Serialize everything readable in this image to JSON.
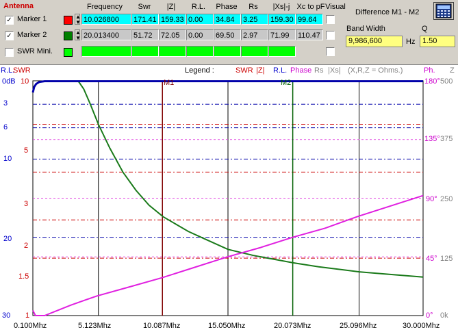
{
  "header": {
    "antenna": "Antenna",
    "columns": [
      "Frequency",
      "Swr",
      "|Z|",
      "R.L.",
      "Phase",
      "Rs",
      "|Xs|-j",
      "Xc to pF",
      "Visual"
    ],
    "difference_title": "Difference M1 - M2",
    "bandwidth_label": "Band Width",
    "bandwidth_value": "9,986,600",
    "hz_label": "Hz",
    "q_label": "Q",
    "q_value": "1.50"
  },
  "markers": [
    {
      "label": "Marker 1",
      "checked": true,
      "color": "#ff0000",
      "values": [
        "10.026800",
        "171.41",
        "159.33",
        "0.00",
        "34.84",
        "3.25",
        "159.30",
        "99.64"
      ]
    },
    {
      "label": "Marker 2",
      "checked": true,
      "color": "#008000",
      "values": [
        "20.013400",
        "51.72",
        "72.05",
        "0.00",
        "69.50",
        "2.97",
        "71.99",
        "110.47"
      ]
    }
  ],
  "swr_mini": {
    "label": "SWR Mini.",
    "checked": false,
    "color": "#00ff00"
  },
  "legend": {
    "left_label": "R.L.",
    "swr_label": "SWR",
    "title": "Legend :",
    "items": [
      {
        "text": "SWR",
        "color": "#cc0000"
      },
      {
        "text": "|Z|",
        "color": "#cc0000"
      },
      {
        "text": "R.L.",
        "color": "#0000cc"
      },
      {
        "text": "Phase",
        "color": "#cc00cc"
      },
      {
        "text": "Rs",
        "color": "#808080"
      },
      {
        "text": "|Xs|",
        "color": "#808080"
      },
      {
        "text": "(X,R,Z = Ohms.)",
        "color": "#808080"
      }
    ],
    "ph_label": "Ph.",
    "z_label": "Z"
  },
  "chart_data": {
    "type": "line",
    "x_ticks": [
      "0.100Mhz",
      "5.123Mhz",
      "10.087Mhz",
      "15.050Mhz",
      "20.073Mhz",
      "25.096Mhz",
      "30.000Mhz"
    ],
    "xlim": [
      0.1,
      30.0
    ],
    "rl_ticks": [
      "0dB",
      "3",
      "6",
      "10",
      "20",
      "30"
    ],
    "swr_ticks": [
      "10",
      "5",
      "3",
      "2",
      "1.5",
      "1"
    ],
    "phase_ticks": [
      "180°",
      "135°",
      "90°",
      "45°",
      "0°"
    ],
    "z_ticks": [
      "500",
      "375",
      "250",
      "125",
      "0k"
    ],
    "markers": [
      {
        "name": "M1",
        "x": 10.0268,
        "color": "#800000"
      },
      {
        "name": "M2",
        "x": 20.0134,
        "color": "#006000"
      }
    ],
    "series": [
      {
        "name": "SWR",
        "color": "#1a7a1a",
        "x": [
          3.56,
          4.0,
          4.5,
          5.12,
          6.0,
          7.0,
          8.0,
          9.0,
          10.09,
          12.0,
          13.0,
          15.05,
          17.0,
          20.07,
          22.0,
          25.1,
          27.0,
          30.0
        ],
        "y": [
          10,
          8.5,
          6.6,
          5.0,
          3.8,
          3.0,
          2.55,
          2.25,
          2.05,
          1.83,
          1.75,
          1.6,
          1.53,
          1.45,
          1.41,
          1.36,
          1.34,
          1.31
        ]
      },
      {
        "name": "Phase",
        "color": "#e020e0",
        "x": [
          0.1,
          0.3,
          0.6,
          1.0,
          2.0,
          3.0,
          5.0,
          7.5,
          10.0,
          12.5,
          15.0,
          17.5,
          20.0,
          22.5,
          25.0,
          27.5,
          30.0
        ],
        "y": [
          4,
          0,
          0,
          0,
          4,
          8,
          15,
          22,
          29,
          37,
          45,
          52,
          60,
          67,
          76,
          84,
          92
        ]
      },
      {
        "name": "R.L.",
        "color": "#0000aa",
        "x": [
          0.1,
          0.2,
          0.35,
          0.6,
          1.0,
          30.0
        ],
        "y": [
          1.5,
          0.8,
          0.4,
          0.15,
          0.05,
          0.05
        ]
      }
    ]
  }
}
